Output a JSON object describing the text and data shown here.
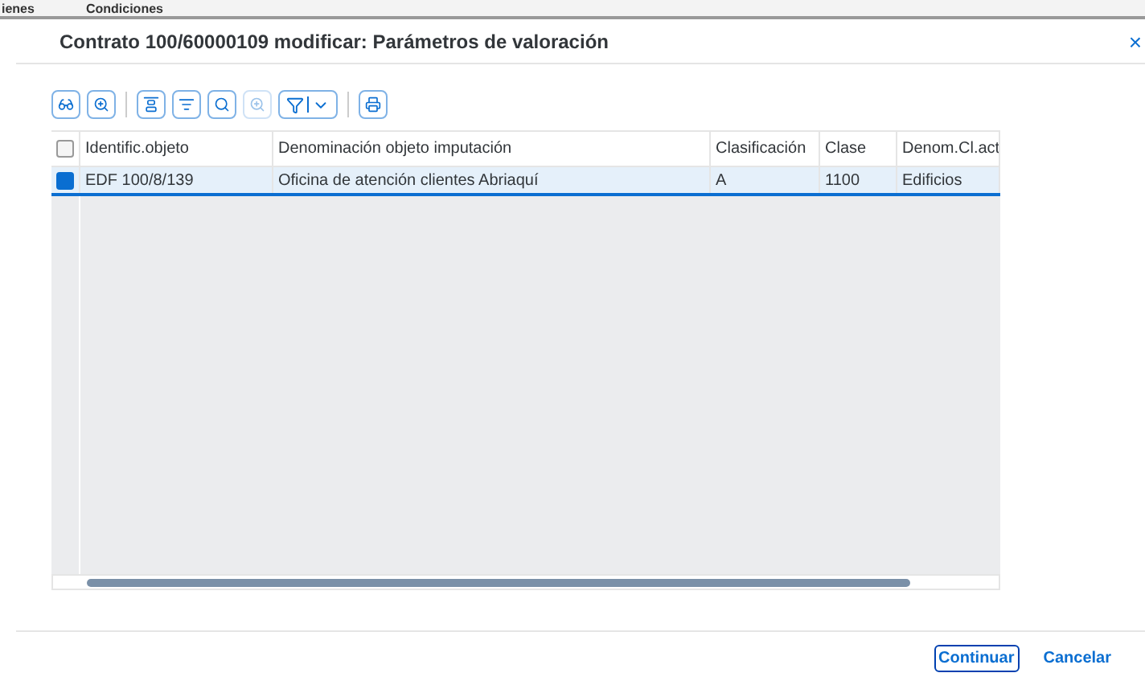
{
  "background_tabs": [
    "ienes",
    "Condiciones"
  ],
  "dialog": {
    "title": "Contrato 100/60000109 modificar: Parámetros de valoración",
    "close": "×"
  },
  "toolbar": [
    {
      "kind": "glasses",
      "disabled": false
    },
    {
      "kind": "zoom",
      "disabled": false
    },
    {
      "kind": "sep"
    },
    {
      "kind": "sort-up",
      "disabled": false
    },
    {
      "kind": "sort-down",
      "disabled": false
    },
    {
      "kind": "search",
      "disabled": false
    },
    {
      "kind": "search-plus",
      "disabled": true
    },
    {
      "kind": "filter",
      "disabled": false
    },
    {
      "kind": "sep"
    },
    {
      "kind": "print",
      "disabled": false
    }
  ],
  "table": {
    "select_all": {
      "checked": false
    },
    "columns": [
      "Identific.objeto",
      "Denominación objeto imputación",
      "Clasificación",
      "Clase",
      "Denom.Cl.act"
    ],
    "rows": [
      {
        "selected": true,
        "cells": [
          "EDF 100/8/139",
          "Oficina de atención clientes Abriaquí",
          "A",
          "1100",
          "Edificios"
        ]
      }
    ]
  },
  "buttons": [
    {
      "label": "Continuar",
      "focused": true
    },
    {
      "label": "Cancelar",
      "focused": false
    }
  ]
}
